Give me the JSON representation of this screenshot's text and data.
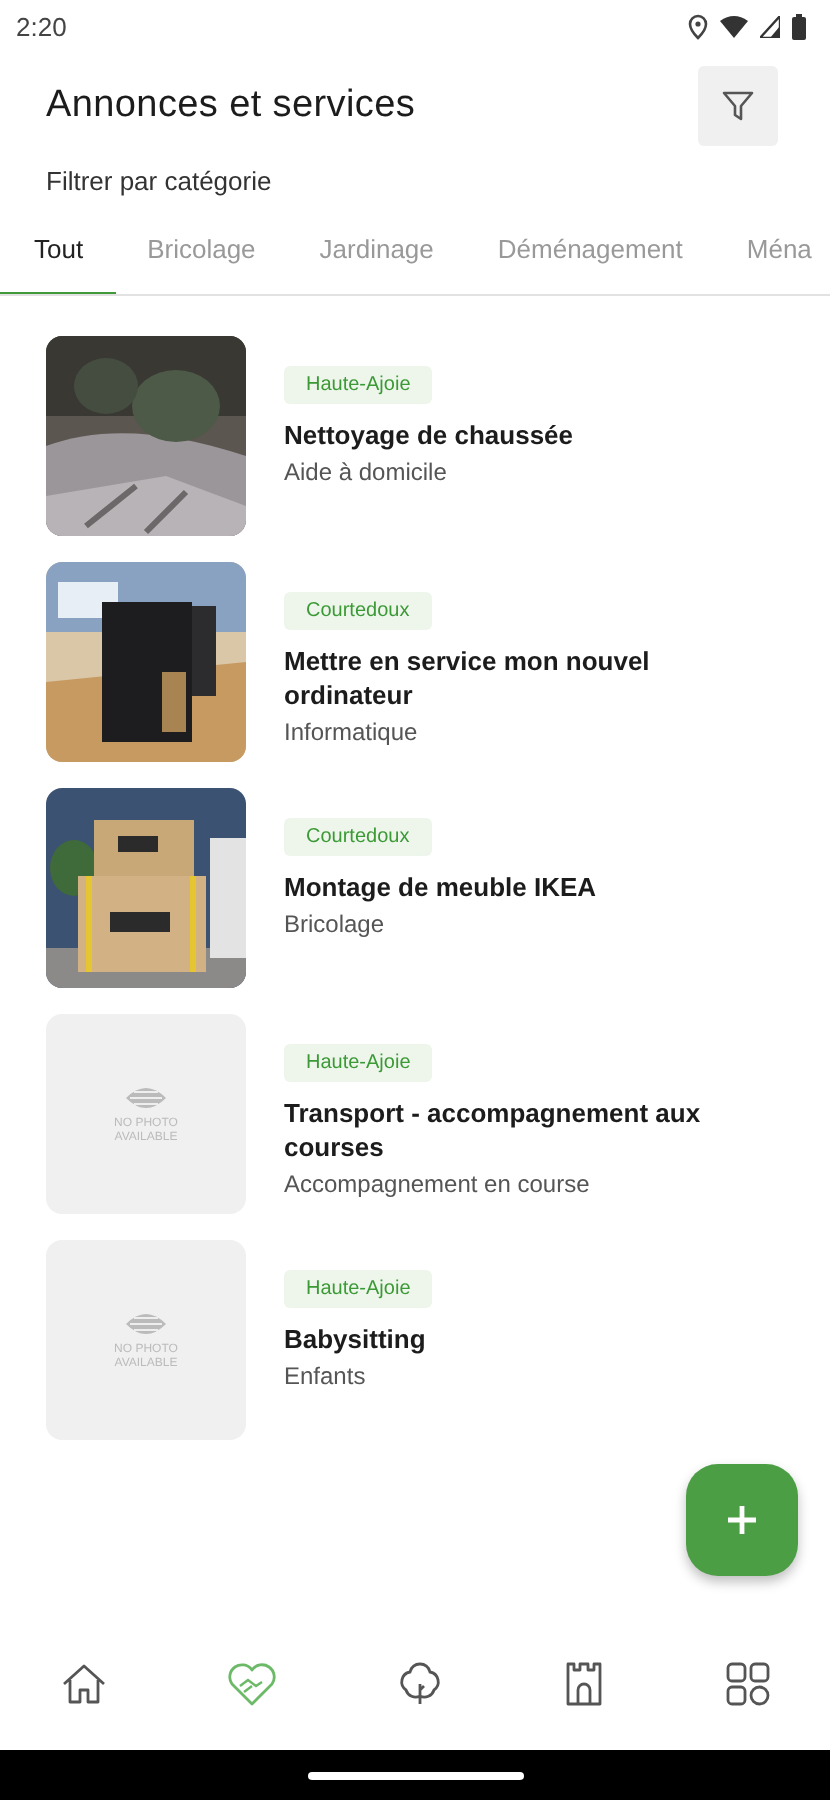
{
  "status_bar": {
    "time": "2:20"
  },
  "header": {
    "title": "Annonces et services",
    "subtitle": "Filtrer par catégorie"
  },
  "tabs": [
    {
      "label": "Tout",
      "selected": true
    },
    {
      "label": "Bricolage",
      "selected": false
    },
    {
      "label": "Jardinage",
      "selected": false
    },
    {
      "label": "Déménagement",
      "selected": false
    },
    {
      "label": "Ména",
      "selected": false
    }
  ],
  "listings": [
    {
      "region": "Haute-Ajoie",
      "title": "Nettoyage de chaussée",
      "category": "Aide à domicile"
    },
    {
      "region": "Courtedoux",
      "title": "Mettre en service mon nouvel ordinateur",
      "category": "Informatique"
    },
    {
      "region": "Courtedoux",
      "title": "Montage de meuble IKEA",
      "category": "Bricolage"
    },
    {
      "image": {
        "kind": "placeholder",
        "text": "NO PHOTO AVAILABLE"
      },
      "region": "Haute-Ajoie",
      "title": "Transport - accompagnement aux courses",
      "category": "Accompagnement en course"
    },
    {
      "image": {
        "kind": "placeholder",
        "text": "NO PHOTO AVAILABLE"
      },
      "region": "Haute-Ajoie",
      "title": "Babysitting",
      "category": "Enfants"
    }
  ],
  "bottom_nav": [
    {
      "selected": false
    },
    {
      "selected": true
    },
    {
      "selected": false
    },
    {
      "selected": false
    },
    {
      "selected": false
    }
  ]
}
